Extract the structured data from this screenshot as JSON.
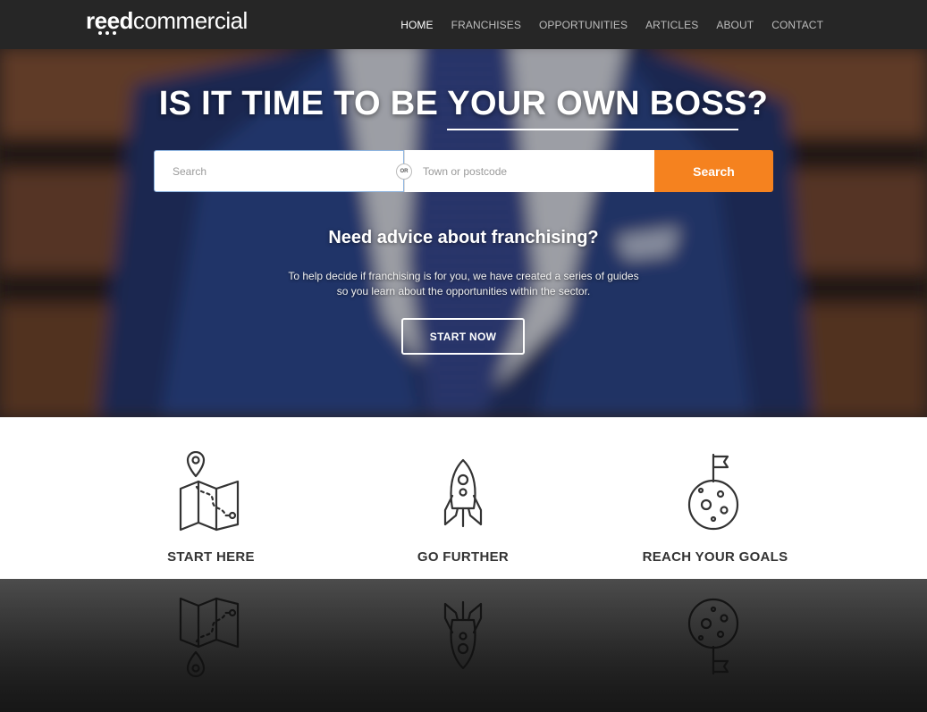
{
  "header": {
    "logo_bold": "reed",
    "logo_light": "commercial",
    "nav": [
      {
        "label": "HOME",
        "active": true
      },
      {
        "label": "FRANCHISES",
        "active": false
      },
      {
        "label": "OPPORTUNITIES",
        "active": false
      },
      {
        "label": "ARTICLES",
        "active": false
      },
      {
        "label": "ABOUT",
        "active": false
      },
      {
        "label": "CONTACT",
        "active": false
      }
    ]
  },
  "hero": {
    "title": "IS IT TIME TO BE YOUR OWN BOSS?",
    "search_placeholder": "Search",
    "or_label": "OR",
    "town_placeholder": "Town or postcode",
    "search_button": "Search",
    "subtitle": "Need advice about franchising?",
    "desc_line1": "To help decide if franchising is for you, we have created a series of guides",
    "desc_line2": "so you learn about the opportunities within the sector.",
    "cta": "START NOW"
  },
  "features": [
    {
      "label": "START HERE",
      "icon": "map-pin-icon"
    },
    {
      "label": "GO FURTHER",
      "icon": "rocket-icon"
    },
    {
      "label": "REACH YOUR GOALS",
      "icon": "moon-flag-icon"
    }
  ],
  "colors": {
    "header_bg": "#262626",
    "accent": "#f5821f",
    "text_dark": "#333333"
  }
}
